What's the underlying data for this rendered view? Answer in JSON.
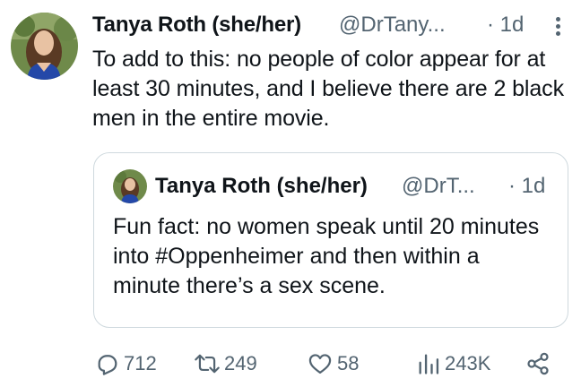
{
  "tweet": {
    "author_name": "Tanya Roth (she/her)",
    "handle": "@DrTany...",
    "dot_time": "· 1d",
    "text": "To add to this: no people of color appear for at least 30 minutes, and I believe there are 2 black men in the entire movie."
  },
  "quote": {
    "author_name": "Tanya Roth (she/her)",
    "handle": "@DrT...",
    "dot_time": "· 1d",
    "text": "Fun fact: no women speak until 20 minutes into #Oppenheimer and then within a minute there’s a sex scene."
  },
  "actions": {
    "replies": "712",
    "reposts": "249",
    "likes": "58",
    "views": "243K"
  },
  "icons": {
    "reply": "reply-icon",
    "repost": "repost-icon",
    "like": "heart-icon",
    "views": "views-icon",
    "share": "share-icon",
    "more": "more-icon"
  },
  "colors": {
    "text": "#0f1419",
    "secondary": "#536471",
    "border": "#cfd9de"
  }
}
